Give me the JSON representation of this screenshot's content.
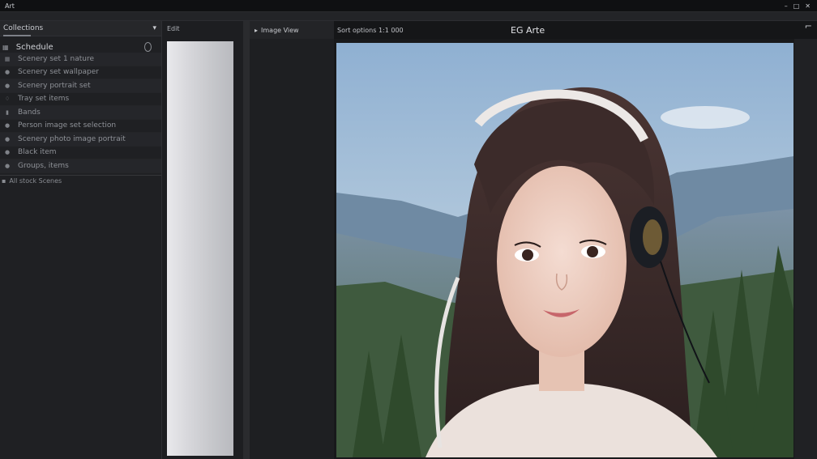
{
  "window": {
    "app_label": "Art",
    "controls": [
      "–",
      "□",
      "✕"
    ]
  },
  "left_panel": {
    "header": "Collections",
    "header_arrow": "▾",
    "tree_title": "Schedule",
    "tree_icon": "grid-icon",
    "items": [
      {
        "icon": "grid-icon",
        "label": "Scenery set 1 nature"
      },
      {
        "icon": "dot-icon",
        "label": "Scenery set wallpaper"
      },
      {
        "icon": "dot-icon",
        "label": "Scenery portrait set"
      },
      {
        "icon": "drop-icon",
        "label": "Tray set items"
      },
      {
        "icon": "bar-icon",
        "label": "Bands"
      },
      {
        "icon": "dot-icon",
        "label": "Person image set selection"
      },
      {
        "icon": "dot-icon",
        "label": "Scenery photo image portrait"
      },
      {
        "icon": "dot-icon",
        "label": "Black item"
      },
      {
        "icon": "dot-icon",
        "label": "Groups, items"
      }
    ],
    "footer": "All stock Scenes"
  },
  "thumb_column": {
    "header": "Edit"
  },
  "viewer": {
    "tab_label": "Image View",
    "toolbar_label": "Sort options 1:1 000",
    "title": "EG Arte",
    "corner_glyph": "⌐"
  },
  "colors": {
    "bg": "#1b1c1e",
    "panel": "#1f2023",
    "accent": "#7d8088"
  }
}
